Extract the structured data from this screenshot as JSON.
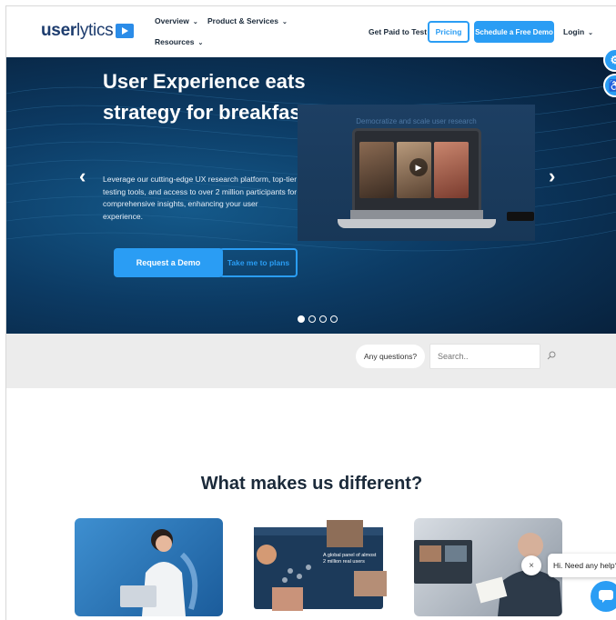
{
  "header": {
    "logo_bold": "user",
    "logo_light": "lytics",
    "nav": [
      {
        "label": "Overview"
      },
      {
        "label": "Product & Services"
      },
      {
        "label": "Resources"
      }
    ],
    "get_paid": "Get Paid to Test",
    "pricing": "Pricing",
    "schedule_demo": "Schedule a Free Demo",
    "login": "Login"
  },
  "hero": {
    "title": "User Experience eats strategy for breakfast",
    "text": "Leverage our cutting-edge UX research platform, top-tier testing tools, and access to over 2 million participants for comprehensive insights, enhancing your user experience.",
    "request_demo": "Request a Demo",
    "plans": "Take me to plans",
    "media_caption": "Democratize and scale user research",
    "slides_total": 4,
    "slide_active": 1
  },
  "search_band": {
    "any_questions": "Any questions?",
    "search_placeholder": "Search.."
  },
  "main": {
    "title": "What makes us different?",
    "card2_text": "A global panel of almost 2 million real users"
  },
  "chat": {
    "bubble": "Hi. Need any help?",
    "close": "×"
  },
  "colors": {
    "accent": "#2a9df4",
    "hero_dark": "#0c3a63",
    "band": "#ececec"
  }
}
